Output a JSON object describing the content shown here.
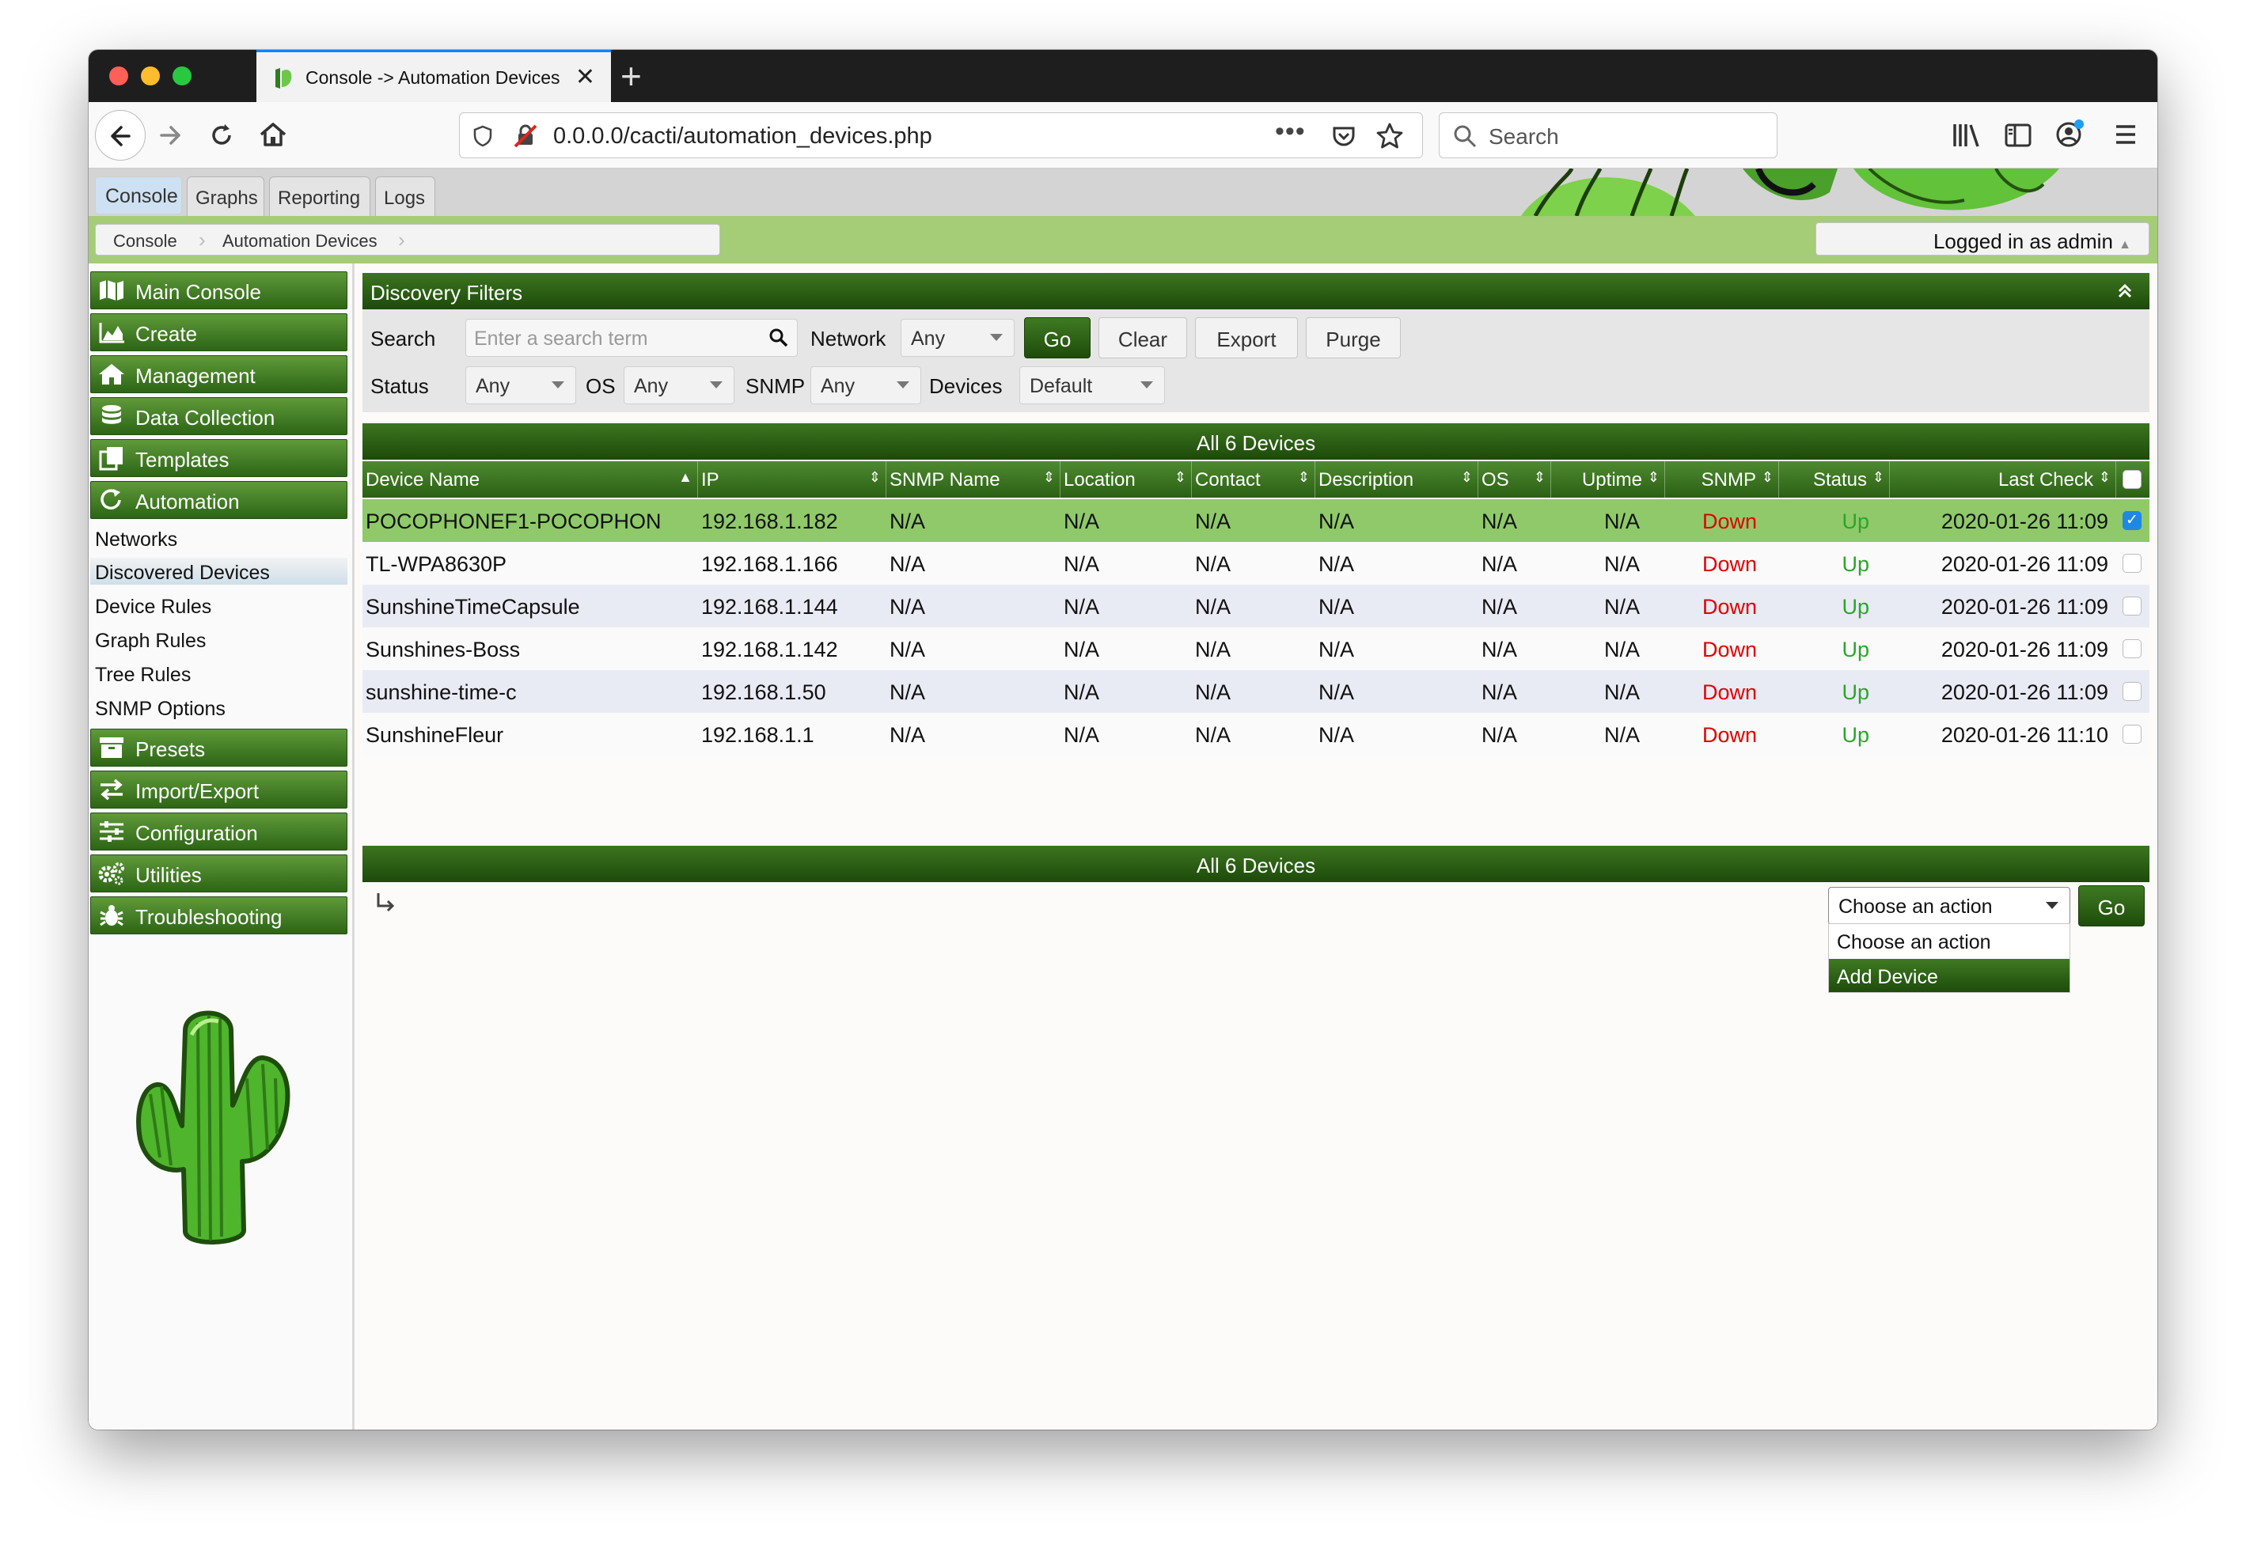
{
  "browser": {
    "tab_title": "Console -> Automation Devices",
    "url": "0.0.0.0/cacti/automation_devices.php",
    "search_placeholder": "Search"
  },
  "top_tabs": [
    "Console",
    "Graphs",
    "Reporting",
    "Logs"
  ],
  "breadcrumb": [
    "Console",
    "Automation Devices"
  ],
  "logged_in": "Logged in as admin",
  "sidebar": {
    "sections_top": [
      "Main Console",
      "Create",
      "Management",
      "Data Collection",
      "Templates",
      "Automation"
    ],
    "automation_items": [
      "Networks",
      "Discovered Devices",
      "Device Rules",
      "Graph Rules",
      "Tree Rules",
      "SNMP Options"
    ],
    "sections_bottom": [
      "Presets",
      "Import/Export",
      "Configuration",
      "Utilities",
      "Troubleshooting"
    ]
  },
  "filters": {
    "title": "Discovery Filters",
    "search_label": "Search",
    "search_placeholder": "Enter a search term",
    "network_label": "Network",
    "network_value": "Any",
    "go": "Go",
    "clear": "Clear",
    "export": "Export",
    "purge": "Purge",
    "status_label": "Status",
    "status_value": "Any",
    "os_label": "OS",
    "os_value": "Any",
    "snmp_label": "SNMP",
    "snmp_value": "Any",
    "devices_label": "Devices",
    "devices_value": "Default"
  },
  "table": {
    "caption": "All 6 Devices",
    "columns": [
      "Device Name",
      "IP",
      "SNMP Name",
      "Location",
      "Contact",
      "Description",
      "OS",
      "Uptime",
      "SNMP",
      "Status",
      "Last Check"
    ],
    "rows": [
      {
        "name": "POCOPHONEF1-POCOPHON",
        "ip": "192.168.1.182",
        "snmp_name": "N/A",
        "location": "N/A",
        "contact": "N/A",
        "description": "N/A",
        "os": "N/A",
        "uptime": "N/A",
        "snmp": "Down",
        "status": "Up",
        "last_check": "2020-01-26 11:09",
        "checked": true
      },
      {
        "name": "TL-WPA8630P",
        "ip": "192.168.1.166",
        "snmp_name": "N/A",
        "location": "N/A",
        "contact": "N/A",
        "description": "N/A",
        "os": "N/A",
        "uptime": "N/A",
        "snmp": "Down",
        "status": "Up",
        "last_check": "2020-01-26 11:09",
        "checked": false
      },
      {
        "name": "SunshineTimeCapsule",
        "ip": "192.168.1.144",
        "snmp_name": "N/A",
        "location": "N/A",
        "contact": "N/A",
        "description": "N/A",
        "os": "N/A",
        "uptime": "N/A",
        "snmp": "Down",
        "status": "Up",
        "last_check": "2020-01-26 11:09",
        "checked": false
      },
      {
        "name": "Sunshines-Boss",
        "ip": "192.168.1.142",
        "snmp_name": "N/A",
        "location": "N/A",
        "contact": "N/A",
        "description": "N/A",
        "os": "N/A",
        "uptime": "N/A",
        "snmp": "Down",
        "status": "Up",
        "last_check": "2020-01-26 11:09",
        "checked": false
      },
      {
        "name": "sunshine-time-c",
        "ip": "192.168.1.50",
        "snmp_name": "N/A",
        "location": "N/A",
        "contact": "N/A",
        "description": "N/A",
        "os": "N/A",
        "uptime": "N/A",
        "snmp": "Down",
        "status": "Up",
        "last_check": "2020-01-26 11:09",
        "checked": false
      },
      {
        "name": "SunshineFleur",
        "ip": "192.168.1.1",
        "snmp_name": "N/A",
        "location": "N/A",
        "contact": "N/A",
        "description": "N/A",
        "os": "N/A",
        "uptime": "N/A",
        "snmp": "Down",
        "status": "Up",
        "last_check": "2020-01-26 11:10",
        "checked": false
      }
    ]
  },
  "action": {
    "select_value": "Choose an action",
    "go": "Go",
    "options": [
      "Choose an action",
      "Add Device"
    ],
    "highlighted": "Add Device"
  },
  "colors": {
    "accent_green": "#2d6515",
    "header_green": "#a5cc76",
    "snmp_down": "#e00000",
    "status_up": "#2aa52a"
  }
}
